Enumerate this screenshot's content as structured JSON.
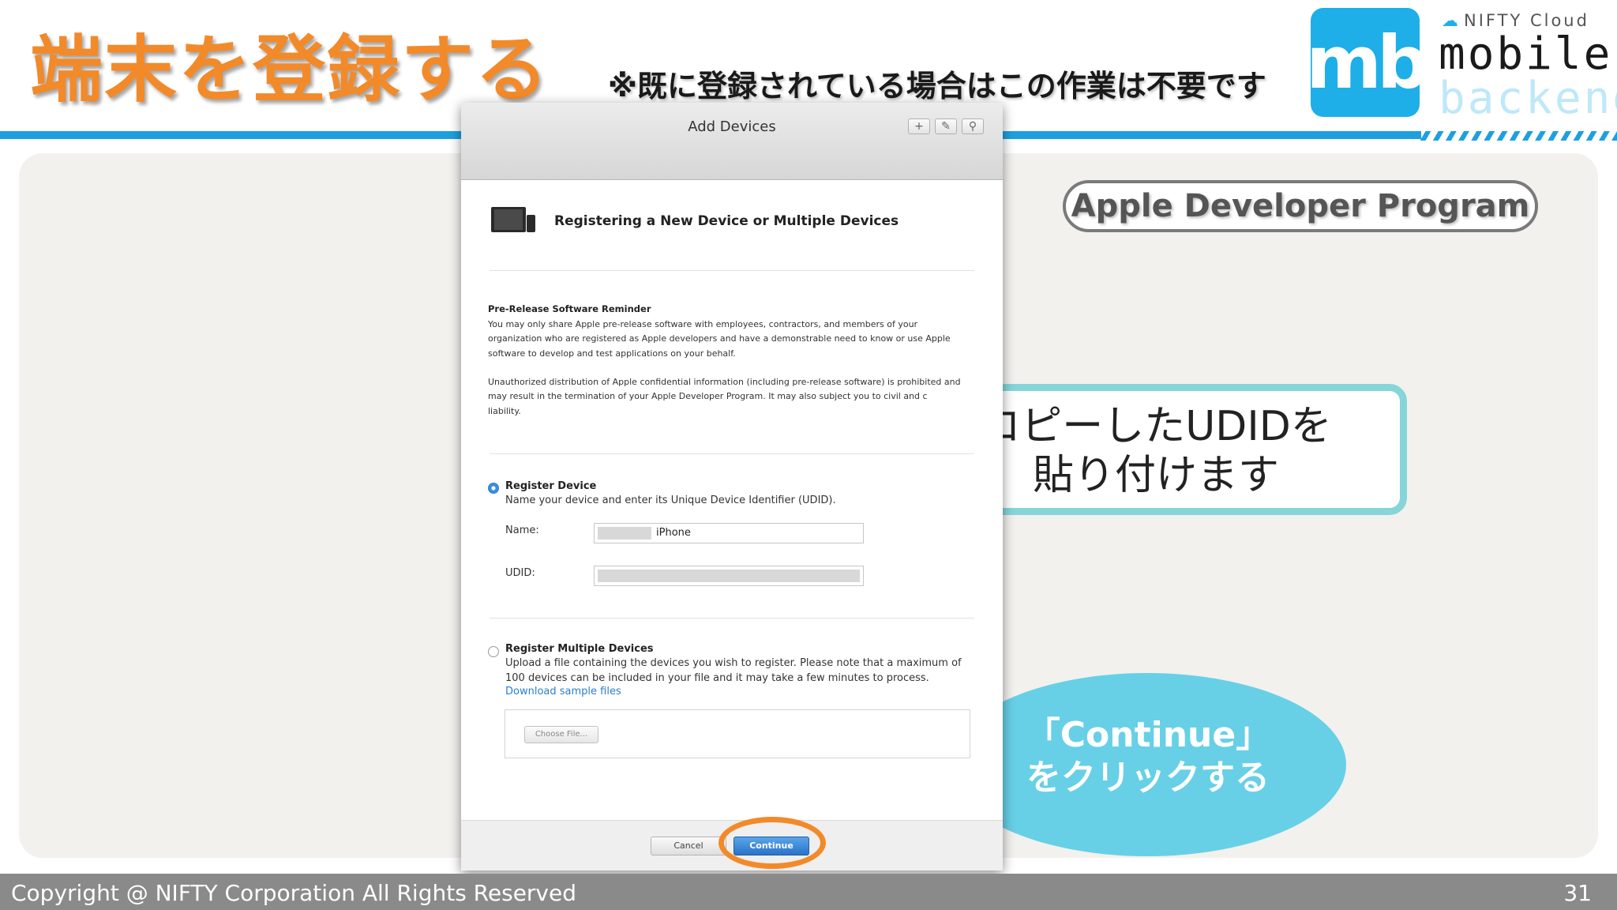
{
  "slide": {
    "title": "端末を登録する",
    "note": "※既に登録されている場合はこの作業は不要です",
    "badge": "Apple Developer Program",
    "page_number": "31",
    "copyright": "Copyright @ NIFTY Corporation All Rights Reserved"
  },
  "logo": {
    "mark": "mb",
    "brand_small": "NIFTY Cloud",
    "word1": "mobile",
    "word2": "backend"
  },
  "window": {
    "title": "Add Devices",
    "toolbar_icons": [
      "plus-icon",
      "edit-icon",
      "search-icon"
    ],
    "section_heading": "Registering a New Device or Multiple Devices",
    "reminder_title": "Pre-Release Software Reminder",
    "reminder_text": "You may only share Apple pre-release software with employees, contractors, and members of your organization who are registered as Apple developers and have a demonstrable need to know or use Apple software to develop and test applications on your behalf.",
    "reminder_text2": "Unauthorized distribution of Apple confidential information (including pre-release software) is prohibited and may result in the termination of your Apple Developer Program. It may also subject you to civil and c liability.",
    "register_device": {
      "title": "Register Device",
      "desc": "Name your device and enter its Unique Device Identifier (UDID).",
      "name_label": "Name:",
      "name_value": "iPhone",
      "udid_label": "UDID:",
      "udid_value": "",
      "selected": true
    },
    "register_multiple": {
      "title": "Register Multiple Devices",
      "desc": "Upload a file containing the devices you wish to register. Please note that a maximum of 100 devices can be included in your file and it may take a few minutes to process.",
      "download_link": "Download sample files",
      "choose_file": "Choose File...",
      "selected": false
    },
    "cancel_label": "Cancel",
    "continue_label": "Continue"
  },
  "callouts": {
    "udid_line1": "コピーしたUDIDを",
    "udid_line2": "貼り付けます",
    "continue_line1": "「Continue」",
    "continue_line2": "をクリックする"
  },
  "colors": {
    "accent_orange": "#f28a2a",
    "accent_blue": "#1ea0e0",
    "callout_teal": "#86d6d9",
    "callout_blue": "#67d0e6",
    "footer_gray": "#8a8a8a"
  }
}
